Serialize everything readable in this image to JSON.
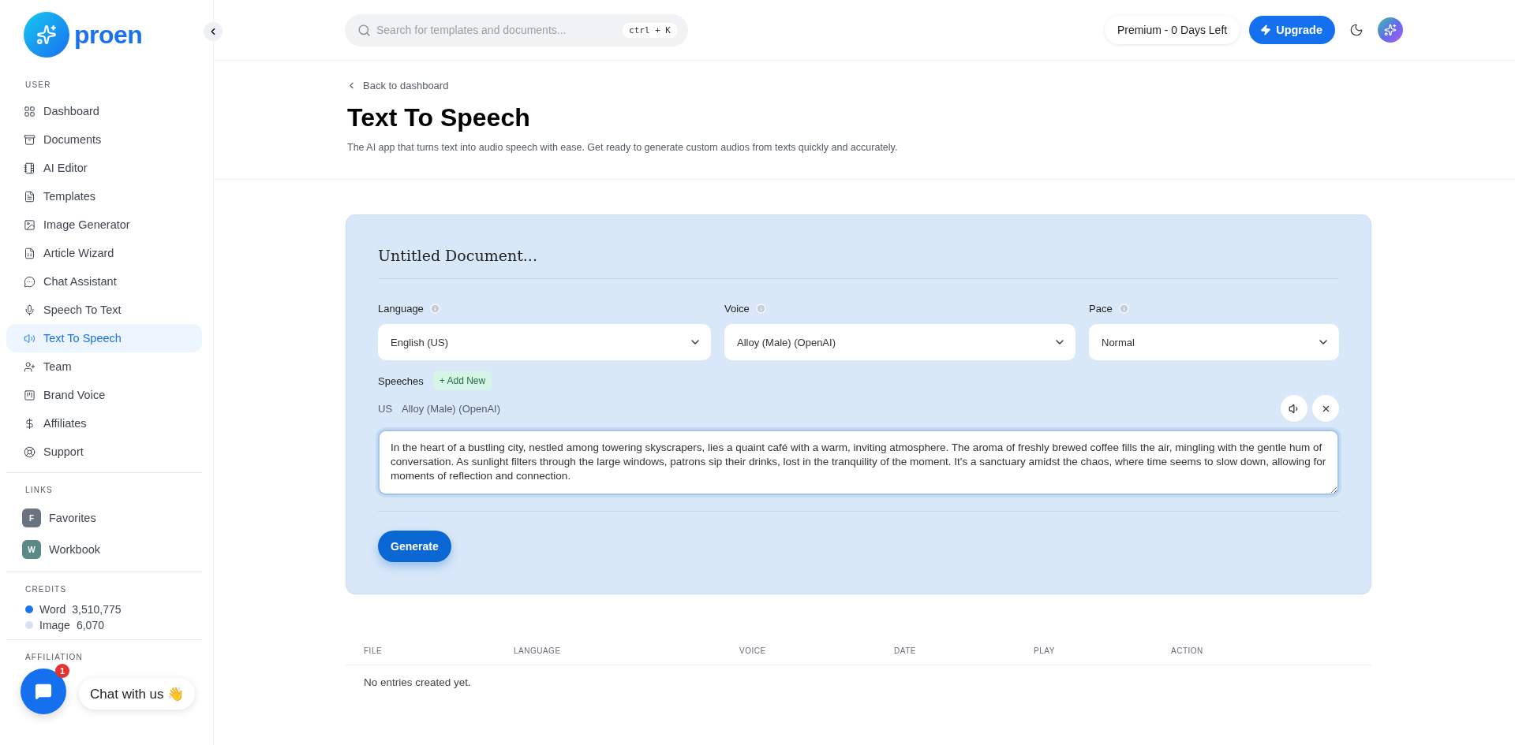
{
  "brand": {
    "name": "proen"
  },
  "sidebar": {
    "sections": [
      {
        "title": "USER",
        "items": [
          {
            "label": "Dashboard",
            "selected": false
          },
          {
            "label": "Documents",
            "selected": false
          },
          {
            "label": "AI Editor",
            "selected": false
          },
          {
            "label": "Templates",
            "selected": false
          },
          {
            "label": "Image Generator",
            "selected": false
          },
          {
            "label": "Article Wizard",
            "selected": false
          },
          {
            "label": "Chat Assistant",
            "selected": false
          },
          {
            "label": "Speech To Text",
            "selected": false
          },
          {
            "label": "Text To Speech",
            "selected": true
          },
          {
            "label": "Team",
            "selected": false
          },
          {
            "label": "Brand Voice",
            "selected": false
          },
          {
            "label": "Affiliates",
            "selected": false
          },
          {
            "label": "Support",
            "selected": false
          }
        ]
      },
      {
        "title": "LINKS",
        "links": [
          {
            "letter": "F",
            "label": "Favorites",
            "color": "#6b7280"
          },
          {
            "letter": "W",
            "label": "Workbook",
            "color": "#5b8a86"
          }
        ]
      },
      {
        "title": "CREDITS",
        "credits": [
          {
            "label": "Word",
            "value": "3,510,775",
            "color": "#1d75f0"
          },
          {
            "label": "Image",
            "value": "6,070",
            "color": "#d8e2ef"
          }
        ]
      },
      {
        "title": "AFFILIATION"
      }
    ]
  },
  "topbar": {
    "search": {
      "placeholder": "Search for templates and documents...",
      "shortcut": "ctrl + K"
    },
    "plan": "Premium - 0 Days Left",
    "upgrade": "Upgrade"
  },
  "header": {
    "back": "Back to dashboard",
    "title": "Text To Speech",
    "subtitle": "The AI app that turns text into audio speech with ease. Get ready to generate custom audios from texts quickly and accurately."
  },
  "editor": {
    "document_title": "Untitled Document...",
    "selects": [
      {
        "label": "Language",
        "value": "English (US)"
      },
      {
        "label": "Voice",
        "value": "Alloy (Male) (OpenAI)"
      },
      {
        "label": "Pace",
        "value": "Normal"
      }
    ],
    "speeches_label": "Speeches",
    "add_new": "+ Add New",
    "speech": {
      "flag": "US",
      "voice": "Alloy (Male) (OpenAI)",
      "text": "In the heart of a bustling city, nestled among towering skyscrapers, lies a quaint café with a warm, inviting atmosphere. The aroma of freshly brewed coffee fills the air, mingling with the gentle hum of conversation. As sunlight filters through the large windows, patrons sip their drinks, lost in the tranquility of the moment. It's a sanctuary amidst the chaos, where time seems to slow down, allowing for moments of reflection and connection."
    },
    "generate": "Generate"
  },
  "table": {
    "columns": [
      "FILE",
      "LANGUAGE",
      "VOICE",
      "DATE",
      "PLAY",
      "ACTION"
    ],
    "empty": "No entries created yet."
  },
  "chat_widget": {
    "badge": "1",
    "label": "Chat with us 👋"
  }
}
